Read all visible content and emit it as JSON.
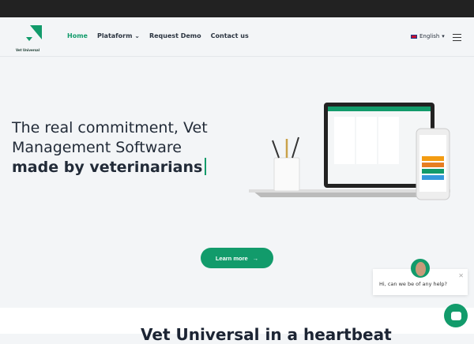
{
  "logo": {
    "text": "Vet Universal"
  },
  "nav": {
    "items": [
      "Home",
      "Plataform",
      "Request Demo",
      "Contact us"
    ],
    "language": "English"
  },
  "hero": {
    "line1": "The real commitment, Vet",
    "line2": "Management Software",
    "line3": "made by veterinarians",
    "button": "Learn more"
  },
  "section": {
    "heading": "Vet Universal in a heartbeat"
  },
  "chat": {
    "message": "Hi, can we be of any help?"
  },
  "colors": {
    "accent": "#129b6b",
    "text": "#222b38"
  }
}
